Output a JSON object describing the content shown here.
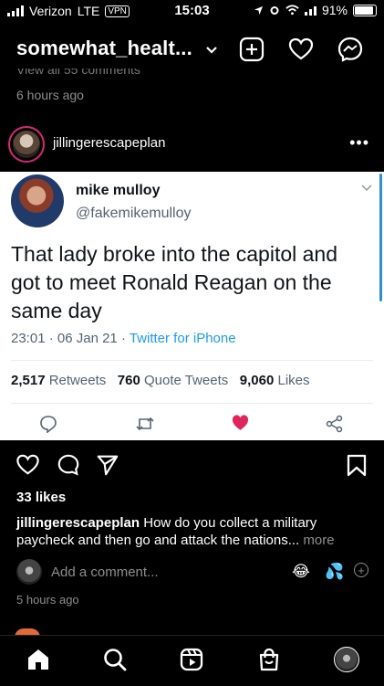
{
  "status_bar": {
    "carrier": "Verizon",
    "network": "LTE",
    "vpn": "VPN",
    "time": "15:03",
    "battery": "91%"
  },
  "header": {
    "account": "somewhat_healt...",
    "icons": [
      "chevron-down-icon",
      "new-post-icon",
      "heart-icon",
      "messenger-icon"
    ]
  },
  "previous_post": {
    "view_all_comments": "View all 55 comments",
    "time_ago": "6 hours ago"
  },
  "post": {
    "username": "jillingerescapeplan",
    "tweet": {
      "display_name": "mike mulloy",
      "handle": "@fakemikemulloy",
      "text": "That lady broke into the capitol and got to meet Ronald Reagan on the same day",
      "time": "23:01",
      "date": "06 Jan 21",
      "source": "Twitter for iPhone",
      "retweets_count": "2,517",
      "retweets_label": "Retweets",
      "quotes_count": "760",
      "quotes_label": "Quote Tweets",
      "likes_count": "9,060",
      "likes_label": "Likes",
      "like_color": "#e0245e"
    },
    "likes_text": "33 likes",
    "caption_user": "jillingerescapeplan",
    "caption_text": "How do you collect a military paycheck and then go and attack the nations...",
    "caption_more": "more",
    "add_comment_placeholder": "Add a comment...",
    "emoji_1": "😂",
    "emoji_2": "💦",
    "time_ago": "5 hours ago"
  },
  "bottom_nav": [
    "home-icon",
    "search-icon",
    "reels-icon",
    "shop-icon",
    "profile-avatar"
  ]
}
